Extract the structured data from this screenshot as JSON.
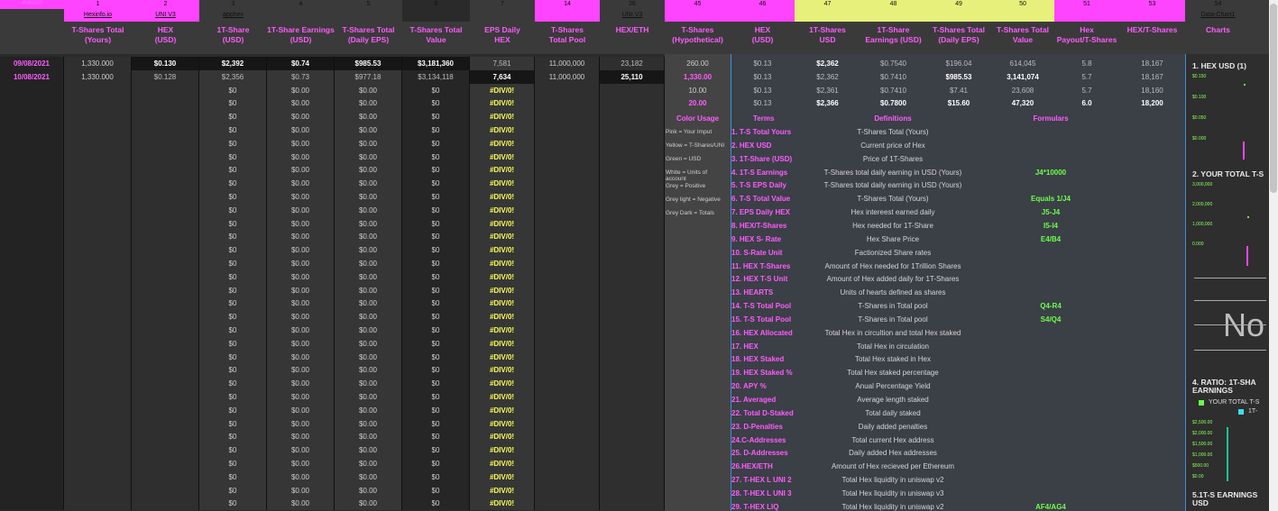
{
  "header": {
    "about": "About",
    "columns": [
      {
        "num": "1",
        "sub": "Hexinfo.io",
        "label": "T-Shares Total\n(Yours)"
      },
      {
        "num": "2",
        "sub": "UNI V3",
        "label": "HEX\n(USD)"
      },
      {
        "num": "3",
        "sub": "apphex",
        "label": "1T-Share\n(USD)"
      },
      {
        "num": "4",
        "sub": "",
        "label": "1T-Share Earnings\n(USD)"
      },
      {
        "num": "5",
        "sub": "",
        "label": "T-Shares Total\n(Daily EPS)"
      },
      {
        "num": "6",
        "sub": "",
        "label": "T-Shares Total\nValue"
      },
      {
        "num": "7",
        "sub": "",
        "label": "EPS Daily\nHEX"
      },
      {
        "num": "14",
        "sub": "",
        "label": "T-Shares\nTotal Pool"
      },
      {
        "num": "26",
        "sub": "UNI V3",
        "label": "HEX/ETH"
      },
      {
        "num": "45",
        "sub": "",
        "label": "T-Shares\n(Hypothetical)"
      },
      {
        "num": "46",
        "sub": "",
        "label": "HEX\n(USD)"
      },
      {
        "num": "47",
        "sub": "",
        "label": "1T-Shares\nUSD"
      },
      {
        "num": "48",
        "sub": "",
        "label": "1T-Share\nEarnings (USD)"
      },
      {
        "num": "49",
        "sub": "",
        "label": "T-Shares Total\n(Daily EPS)"
      },
      {
        "num": "50",
        "sub": "",
        "label": "T-Shares Total\nValue"
      },
      {
        "num": "51",
        "sub": "",
        "label": "Hex\nPayout/T-Shares"
      },
      {
        "num": "53",
        "sub": "",
        "label": "HEX/T-Shares"
      },
      {
        "num": "54",
        "sub": "Data-Chart1",
        "label": "Charts"
      }
    ]
  },
  "rows": [
    {
      "date": "09/08/2021",
      "c1": "1,330.000",
      "c2": "$0.130",
      "c3": "$2,392",
      "c4": "$0.74",
      "c5": "$985.53",
      "c6": "$3,181,360",
      "c7": "7,581",
      "c8": "11,000,000",
      "c9": "23,182"
    },
    {
      "date": "10/08/2021",
      "c1": "1,330.000",
      "c2": "$0.128",
      "c3": "$2,356",
      "c4": "$0.73",
      "c5": "$977.18",
      "c6": "$3,134,118",
      "c7": "7,634",
      "c8": "11,000,000",
      "c9": "25,110"
    }
  ],
  "empty_row": {
    "c3": "$0",
    "c4": "$0.00",
    "c5": "$0.00",
    "c6": "$0",
    "c7": "#DIV/0!"
  },
  "hypo": {
    "t_shares": [
      "260.00",
      "1,330.00",
      "10.00",
      "20.00"
    ],
    "hex_usd": [
      "$0.13",
      "$0.13",
      "$0.13",
      "$0.13"
    ],
    "share_usd": [
      "$2,362",
      "$2,362",
      "$2,361",
      "$2,366"
    ],
    "earn": [
      "$0.7540",
      "$0.7410",
      "$0.7410",
      "$0.7800"
    ],
    "eps": [
      "$196.04",
      "$985.53",
      "$7.41",
      "$15.60"
    ],
    "value": [
      "614,045",
      "3,141,074",
      "23,608",
      "47,320"
    ],
    "payout": [
      "5.8",
      "5.7",
      "5.7",
      "6.0"
    ],
    "hex_t": [
      "18,167",
      "18,167",
      "18,160",
      "18,200"
    ]
  },
  "legend": {
    "title": "Color Usage",
    "items": [
      "Pink = Your Imput",
      "Yellow = T-Shares/UNI",
      "Green = USD",
      "White = Units of account",
      "Grey = Positive",
      "Grey light = Negative",
      "Grey Dark = Totals"
    ]
  },
  "terms_header": {
    "terms": "Terms",
    "definitions": "Definitions",
    "formulas": "Formulars"
  },
  "terms": [
    {
      "t": "1.  T-S Total Yours",
      "d": "T-Shares Total (Yours)",
      "f": ""
    },
    {
      "t": "2.  HEX USD",
      "d": "Current price of Hex",
      "f": ""
    },
    {
      "t": "3.  1T-Share (USD)",
      "d": "Price of 1T-Shares",
      "f": ""
    },
    {
      "t": "4.  1T-S Earnings",
      "d": "T-Shares total daily earning in USD (Yours)",
      "f": "J4*10000"
    },
    {
      "t": "5.  T-S EPS Daily",
      "d": "T-Shares total daily earning in USD (Yours)",
      "f": ""
    },
    {
      "t": "6.  T-S Total Value",
      "d": "T-Shares Total (Yours)",
      "f": "Equals 1/J4"
    },
    {
      "t": "7.  EPS Daily HEX",
      "d": "Hex intereest earned daily",
      "f": "J5-J4"
    },
    {
      "t": "8.  HEX/T-Shares",
      "d": "Hex needed for 1T-Share",
      "f": "I5-I4"
    },
    {
      "t": "9.  HEX S- Rate",
      "d": "Hex Share Price",
      "f": "E4/B4"
    },
    {
      "t": "10.  S-Rate Unit",
      "d": "Factionized  Share rates",
      "f": ""
    },
    {
      "t": "11. HEX T-Shares",
      "d": "Amount of Hex needed for 1Trillion Shares",
      "f": ""
    },
    {
      "t": "12.  HEX T-S Unit",
      "d": "Amount of Hex added daily for 1T-Shares",
      "f": ""
    },
    {
      "t": "13.  HEARTS",
      "d": "Units of hearts defined as shares",
      "f": ""
    },
    {
      "t": "14. T-S Total Pool",
      "d": "T-Shares in Total pool",
      "f": "Q4-R4"
    },
    {
      "t": "15.  T-S Total Pool",
      "d": "T-Shares in Total pool",
      "f": "S4/Q4"
    },
    {
      "t": "16.  HEX Allocated",
      "d": "Total Hex in circultion and total Hex staked",
      "f": ""
    },
    {
      "t": "17. HEX",
      "d": "Total Hex in circulation",
      "f": ""
    },
    {
      "t": "18. HEX Staked",
      "d": "Total Hex staked in Hex",
      "f": ""
    },
    {
      "t": "19. HEX Staked %",
      "d": "Total Hex staked percentage",
      "f": ""
    },
    {
      "t": "20. APY %",
      "d": "Anual Percentage Yield",
      "f": ""
    },
    {
      "t": "21. Averaged",
      "d": "Average length staked",
      "f": ""
    },
    {
      "t": "22. Total D-Staked",
      "d": "Total daily staked",
      "f": ""
    },
    {
      "t": "23. D-Penalties",
      "d": "Daily added penalties",
      "f": ""
    },
    {
      "t": "24.C-Addresses",
      "d": "Total current Hex address",
      "f": ""
    },
    {
      "t": "25. D-Addresses",
      "d": "Daily added Hex addresses",
      "f": ""
    },
    {
      "t": "26.HEX/ETH",
      "d": "Amount of Hex recieved per Ethereum",
      "f": ""
    },
    {
      "t": "27. T-HEX L UNI 2",
      "d": "Total Hex liquidity in uniswap v2",
      "f": ""
    },
    {
      "t": "28. T-HEX L UNI 3",
      "d": "Total Hex liquidity in uniswap v3",
      "f": ""
    },
    {
      "t": "29. T-HEX LIQ",
      "d": "Total Hex liquidity in uniswap v2",
      "f": "AF4/AG4"
    }
  ],
  "charts": {
    "c1_title": "1. HEX USD (1)",
    "c1_ticks": [
      "$0.150",
      "$0.100",
      "$0.050",
      "$0.000"
    ],
    "c2_title": "2. YOUR TOTAL T-S",
    "c2_ticks": [
      "3,000,000",
      "2,000,000",
      "1,000,000",
      "0.000"
    ],
    "no_text": "No",
    "c4_title": "4. RATIO: 1T-SHA\nEARNINGS",
    "c4_legend1": "YOUR TOTAL T-S",
    "c4_legend2": "1T-",
    "c4_ticks": [
      "$2,500.00",
      "$2,000.00",
      "$1,500.00",
      "$1,000.00",
      "$500.00",
      "$0.00"
    ],
    "c5_title": "5.1T-S EARNINGS\nUSD"
  },
  "colors": {
    "pink": "#ff44ff",
    "yellow": "#e6f07a",
    "green": "#6bff4b",
    "date": "#ff5cff"
  }
}
